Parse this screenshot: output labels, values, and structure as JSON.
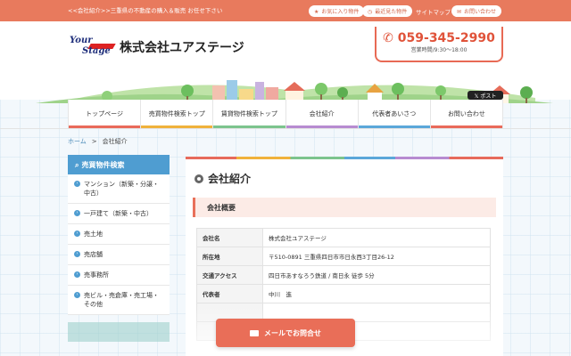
{
  "topbar": {
    "tagline": "<<会社紹介>>三重県の不動産の購入＆販売 お任せ下さい",
    "favorites": "お気に入り物件",
    "recent": "最近見た物件",
    "sitemap": "サイトマップ",
    "contact": "お問い合わせ"
  },
  "header": {
    "logo_line1": "Your",
    "logo_line2": "Stage",
    "company": "株式会社ユアステージ",
    "phone": "059-345-2990",
    "hours": "営業時間/9:30～18:00",
    "tweet": "ポスト"
  },
  "nav": [
    {
      "label": "トップページ",
      "color": "#e96a5a"
    },
    {
      "label": "売買物件検索トップ",
      "color": "#f0b23b"
    },
    {
      "label": "賃貸物件検索トップ",
      "color": "#7cc48d"
    },
    {
      "label": "会社紹介",
      "color": "#b78bd1"
    },
    {
      "label": "代表者あいさつ",
      "color": "#5ba7d9"
    },
    {
      "label": "お問い合わせ",
      "color": "#e96a5a"
    }
  ],
  "breadcrumb": {
    "home": "ホーム",
    "sep": ">",
    "current": "会社紹介"
  },
  "sidebar": {
    "heading": "売買物件検索",
    "items": [
      {
        "label": "マンション（新築・分譲・中古）"
      },
      {
        "label": "一戸建て（新築・中古）"
      },
      {
        "label": "売土地"
      },
      {
        "label": "売店舗"
      },
      {
        "label": "売事務所"
      },
      {
        "label": "売ビル・売倉庫・売工場・その他"
      }
    ]
  },
  "main": {
    "title": "会社紹介",
    "section": "会社概要",
    "rows": [
      {
        "k": "会社名",
        "v": "株式会社ユアステージ"
      },
      {
        "k": "所在地",
        "v": "〒510-0891 三重県四日市市日永西3丁目26-12"
      },
      {
        "k": "交通アクセス",
        "v": "四日市あすなろう鉄道 / 南日永 徒歩 5分"
      },
      {
        "k": "代表者",
        "v": "中川　進"
      }
    ]
  },
  "mail_button": "メールでお問合せ",
  "colors": {
    "accent": "#e96e58",
    "blue": "#4f9dd1"
  }
}
